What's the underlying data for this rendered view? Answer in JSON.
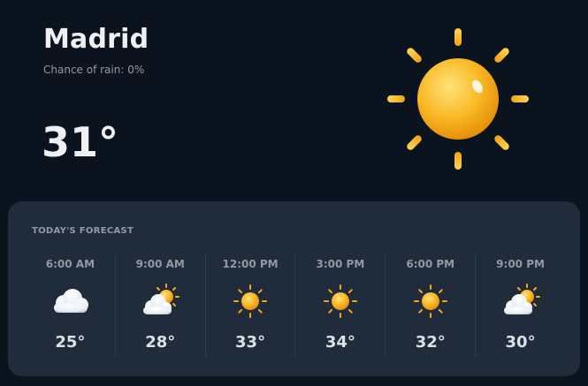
{
  "current": {
    "city": "Madrid",
    "chance_of_rain": "Chance of rain: 0%",
    "temperature": "31°",
    "icon": "sun-icon"
  },
  "forecast": {
    "title": "TODAY'S FORECAST",
    "slots": [
      {
        "time": "6:00 AM",
        "temp": "25°",
        "icon": "cloud-icon"
      },
      {
        "time": "9:00 AM",
        "temp": "28°",
        "icon": "partly-cloudy-icon"
      },
      {
        "time": "12:00 PM",
        "temp": "33°",
        "icon": "sun-icon"
      },
      {
        "time": "3:00 PM",
        "temp": "34°",
        "icon": "sun-icon"
      },
      {
        "time": "6:00 PM",
        "temp": "32°",
        "icon": "sun-icon"
      },
      {
        "time": "9:00 PM",
        "temp": "30°",
        "icon": "partly-cloudy-icon"
      }
    ]
  },
  "colors": {
    "background": "#0b131e",
    "card": "#202b3b",
    "muted_text": "#9399a2",
    "sun": "#f7b31f"
  }
}
